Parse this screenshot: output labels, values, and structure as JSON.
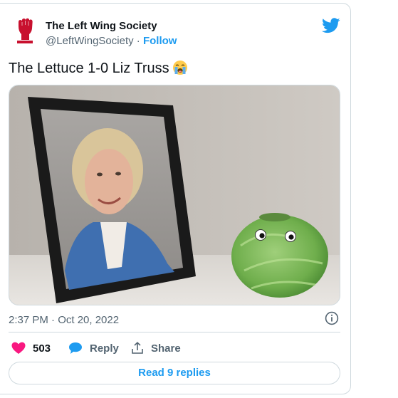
{
  "author": {
    "display_name": "The Left Wing Society",
    "handle": "@LeftWingSociety",
    "separator": " · ",
    "follow_label": "Follow",
    "avatar_icon": "raised-fist-icon",
    "brand_color": "#c8102e"
  },
  "tweet": {
    "text": "The Lettuce 1-0 Liz Truss",
    "emoji_icon": "loudly-crying-face-icon"
  },
  "meta": {
    "timestamp": "2:37 PM · Oct 20, 2022"
  },
  "actions": {
    "likes_count": "503",
    "reply_label": "Reply",
    "share_label": "Share"
  },
  "footer": {
    "read_replies_label": "Read 9 replies"
  },
  "colors": {
    "accent": "#1d9bf0",
    "like": "#f91880",
    "muted": "#536471"
  }
}
